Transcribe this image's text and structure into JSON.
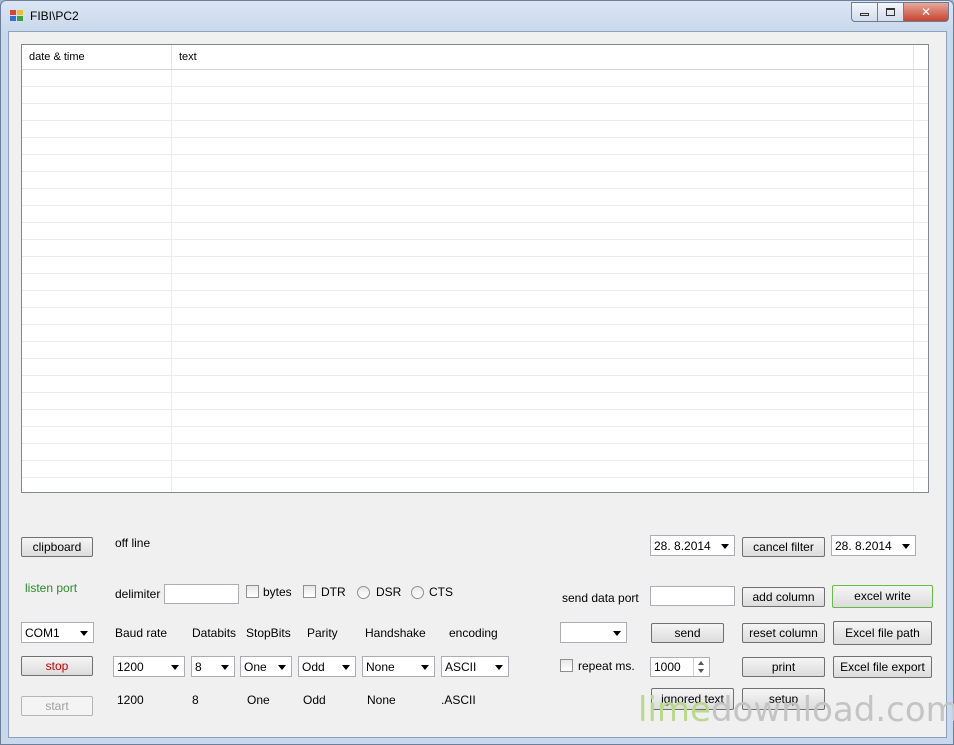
{
  "window": {
    "title": "FIBI\\PC2",
    "min": "▭",
    "max": "▣",
    "close": "✕"
  },
  "grid": {
    "columns": [
      "date & time",
      "text"
    ]
  },
  "buttons": {
    "clipboard": "clipboard",
    "stop": "stop",
    "start": "start",
    "cancel_filter": "cancel filter",
    "add_column": "add column",
    "excel_write": "excel write",
    "send": "send",
    "reset_column": "reset column",
    "excel_file_path": "Excel file path",
    "print": "print",
    "excel_file_export": "Excel file export",
    "ignored_text": "ignored text",
    "setup": "setup"
  },
  "labels": {
    "status": "off line",
    "listen_port": "listen port",
    "delimiter": "delimiter",
    "bytes": "bytes",
    "dtr": "DTR",
    "dsr": "DSR",
    "cts": "CTS",
    "send_data_port": "send data port",
    "repeat_ms": "repeat ms.",
    "baud_rate": "Baud rate",
    "databits": "Databits",
    "stopbits": "StopBits",
    "parity": "Parity",
    "handshake": "Handshake",
    "encoding": "encoding"
  },
  "values": {
    "port": "COM1",
    "baud": "1200",
    "databits": "8",
    "stopbits": "One",
    "parity": "Odd",
    "handshake": "None",
    "encoding": "ASCII",
    "date_from": "28.  8.2014",
    "date_to": "28.  8.2014",
    "repeat": "1000",
    "cur_baud": "1200",
    "cur_databits": "8",
    "cur_stopbits": "One",
    "cur_parity": "Odd",
    "cur_handshake": "None",
    "cur_encoding": ".ASCII"
  },
  "watermark": {
    "part1": "lime",
    "part2": "download.com"
  }
}
